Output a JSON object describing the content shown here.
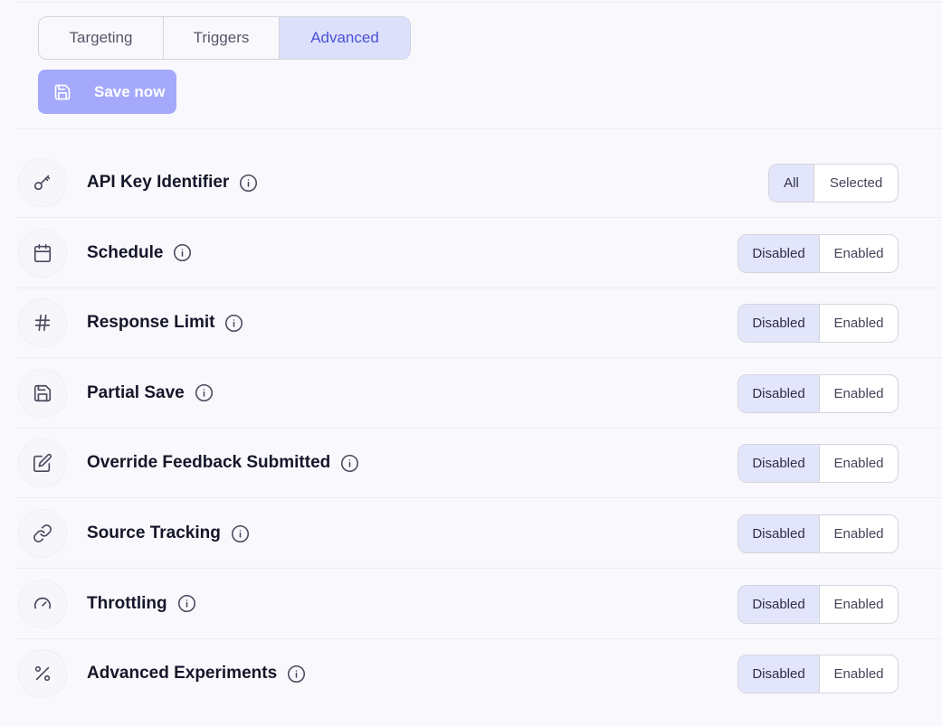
{
  "tabs": [
    {
      "label": "Targeting",
      "active": false
    },
    {
      "label": "Triggers",
      "active": false
    },
    {
      "label": "Advanced",
      "active": true
    }
  ],
  "save_button": {
    "label": "Save now",
    "icon": "save-icon"
  },
  "settings": [
    {
      "title": "API Key Identifier",
      "icon": "key-icon",
      "options": [
        "All",
        "Selected"
      ],
      "selected": "All"
    },
    {
      "title": "Schedule",
      "icon": "calendar-icon",
      "options": [
        "Disabled",
        "Enabled"
      ],
      "selected": "Disabled"
    },
    {
      "title": "Response Limit",
      "icon": "hash-icon",
      "options": [
        "Disabled",
        "Enabled"
      ],
      "selected": "Disabled"
    },
    {
      "title": "Partial Save",
      "icon": "save-icon",
      "options": [
        "Disabled",
        "Enabled"
      ],
      "selected": "Disabled"
    },
    {
      "title": "Override Feedback Submitted",
      "icon": "edit-icon",
      "options": [
        "Disabled",
        "Enabled"
      ],
      "selected": "Disabled"
    },
    {
      "title": "Source Tracking",
      "icon": "link-icon",
      "options": [
        "Disabled",
        "Enabled"
      ],
      "selected": "Disabled"
    },
    {
      "title": "Throttling",
      "icon": "gauge-icon",
      "options": [
        "Disabled",
        "Enabled"
      ],
      "selected": "Disabled"
    },
    {
      "title": "Advanced Experiments",
      "icon": "percent-icon",
      "options": [
        "Disabled",
        "Enabled"
      ],
      "selected": "Disabled"
    }
  ],
  "colors": {
    "accent": "#4a52d6",
    "save_button_bg": "#a4a9fb",
    "active_segment_bg": "#e3e6fa",
    "active_tab_bg": "#dde0fb"
  }
}
